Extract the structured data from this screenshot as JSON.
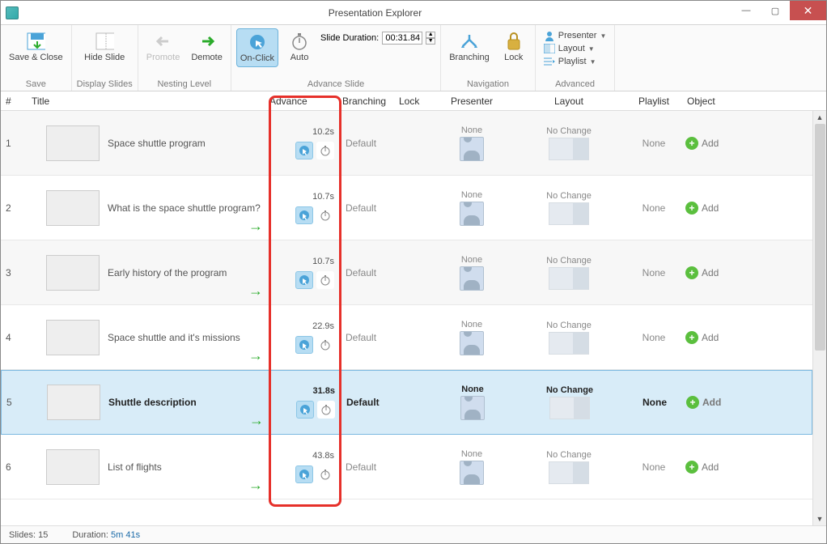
{
  "window": {
    "title": "Presentation Explorer"
  },
  "ribbon": {
    "save": {
      "label": "Save & Close",
      "group": "Save"
    },
    "display": {
      "hide": "Hide Slide",
      "group": "Display Slides"
    },
    "nesting": {
      "promote": "Promote",
      "demote": "Demote",
      "group": "Nesting Level"
    },
    "advance": {
      "onclick": "On-Click",
      "auto": "Auto",
      "dur_label": "Slide Duration:",
      "dur_value": "00:31.84",
      "group": "Advance Slide"
    },
    "nav": {
      "branching": "Branching",
      "lock": "Lock",
      "group": "Navigation"
    },
    "advanced": {
      "presenter": "Presenter",
      "layout": "Layout",
      "playlist": "Playlist",
      "group": "Advanced"
    }
  },
  "columns": {
    "num": "#",
    "title": "Title",
    "advance": "Advance",
    "branching": "Branching",
    "lock": "Lock",
    "presenter": "Presenter",
    "layout": "Layout",
    "playlist": "Playlist",
    "object": "Object"
  },
  "slides": [
    {
      "num": "1",
      "title": "Space shuttle program",
      "advance": "10.2s",
      "branching": "Default",
      "presenter": "None",
      "layout": "No Change",
      "playlist": "None",
      "add": "Add",
      "indent": false,
      "demote_arrow": false,
      "click_on": true,
      "timer_on": false,
      "selected": false
    },
    {
      "num": "2",
      "title": "What is the space shuttle program?",
      "advance": "10.7s",
      "branching": "Default",
      "presenter": "None",
      "layout": "No Change",
      "playlist": "None",
      "add": "Add",
      "indent": false,
      "demote_arrow": true,
      "click_on": true,
      "timer_on": false,
      "selected": false
    },
    {
      "num": "3",
      "title": "Early history of the program",
      "advance": "10.7s",
      "branching": "Default",
      "presenter": "None",
      "layout": "No Change",
      "playlist": "None",
      "add": "Add",
      "indent": false,
      "demote_arrow": true,
      "click_on": true,
      "timer_on": false,
      "selected": false
    },
    {
      "num": "4",
      "title": "Space shuttle and it's missions",
      "advance": "22.9s",
      "branching": "Default",
      "presenter": "None",
      "layout": "No Change",
      "playlist": "None",
      "add": "Add",
      "indent": false,
      "demote_arrow": true,
      "click_on": true,
      "timer_on": false,
      "selected": false
    },
    {
      "num": "5",
      "title": "Shuttle description",
      "advance": "31.8s",
      "branching": "Default",
      "presenter": "None",
      "layout": "No Change",
      "playlist": "None",
      "add": "Add",
      "indent": false,
      "demote_arrow": true,
      "click_on": true,
      "timer_on": false,
      "selected": true
    },
    {
      "num": "6",
      "title": "List of flights",
      "advance": "43.8s",
      "branching": "Default",
      "presenter": "None",
      "layout": "No Change",
      "playlist": "None",
      "add": "Add",
      "indent": false,
      "demote_arrow": true,
      "click_on": true,
      "timer_on": false,
      "selected": false
    }
  ],
  "status": {
    "slides_label": "Slides:",
    "slides_value": "15",
    "dur_label": "Duration:",
    "dur_value": "5m 41s"
  }
}
